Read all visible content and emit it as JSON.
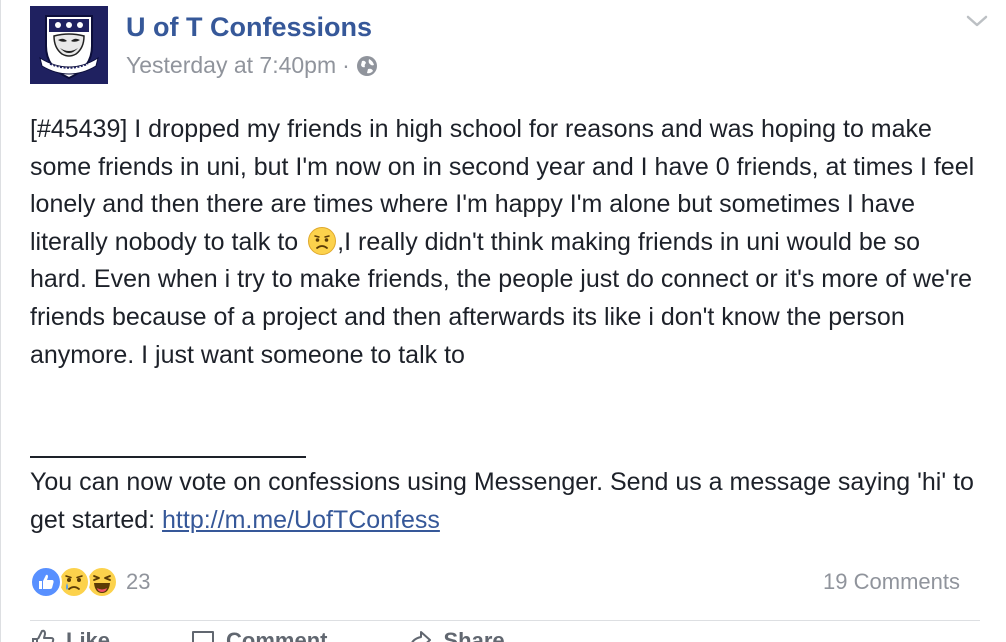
{
  "post": {
    "page_name": "U of T Confessions",
    "timestamp": "Yesterday at 7:40pm",
    "meta_separator": "·",
    "body_before_emoji": "[#45439] I dropped my friends in high school for reasons and was hoping to make some friends in uni, but I'm now on in second year and I have 0 friends, at times I feel lonely and then there are times where I'm happy I'm alone but sometimes I have literally nobody to talk to",
    "body_after_emoji": ",I really didn't think making friends in uni would be so hard. Even when i try to make friends, the people just do connect or it's more of we're friends because of a project and then afterwards its like i don't know the person anymore. I just want someone to talk to",
    "footer_text": "You can now vote on confessions using Messenger. Send us a message saying 'hi' to get started:",
    "footer_link": "http://m.me/UofTConfess",
    "inline_emoji": "sad-face"
  },
  "stats": {
    "reactions": [
      "like",
      "sad",
      "haha"
    ],
    "reaction_count": "23",
    "comments": "19 Comments"
  },
  "actions": {
    "like": "Like",
    "comment": "Comment",
    "share": "Share"
  },
  "colors": {
    "link": "#365899",
    "meta": "#90949c",
    "text": "#1d2129",
    "like_blue": "#5890ff",
    "emoji_yellow": "#fcd24c"
  }
}
